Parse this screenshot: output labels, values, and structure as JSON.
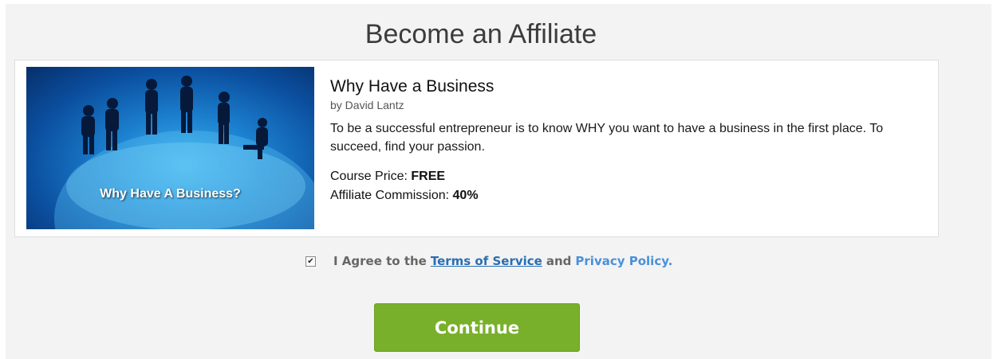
{
  "page": {
    "title": "Become an Affiliate"
  },
  "course": {
    "image_caption": "Why Have A Business?",
    "title": "Why Have a Business",
    "author": "by David Lantz",
    "description": "To be a successful entrepreneur is to know WHY you want to have a business in the first place. To succeed, find your passion.",
    "price_label": "Course Price: ",
    "price_value": "FREE",
    "commission_label": "Affiliate Commission: ",
    "commission_value": "40%"
  },
  "agreement": {
    "checked": true,
    "prefix": "I Agree to the",
    "terms_label": "Terms of Service",
    "and_label": "and",
    "privacy_label": "Privacy Policy."
  },
  "actions": {
    "continue_label": "Continue"
  },
  "colors": {
    "button": "#79b02b",
    "link": "#2a6eb0",
    "background": "#f3f3f3"
  }
}
